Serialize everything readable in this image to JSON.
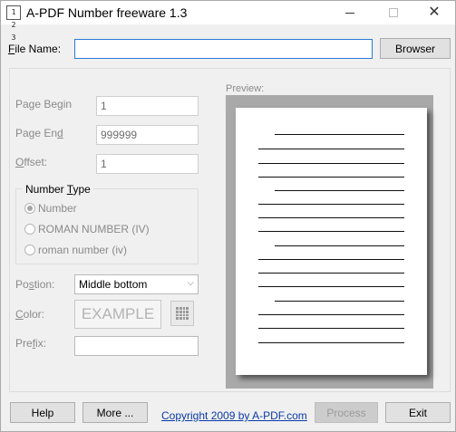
{
  "window": {
    "title": "A-PDF Number freeware 1.3",
    "icon_text": "1 2 3",
    "close_glyph": "✕"
  },
  "file": {
    "label_prefix": "F",
    "label_rest": "ile Name:",
    "value": "",
    "browse_label": "Browser"
  },
  "fields": {
    "page_begin_label": "Page Begin",
    "page_begin_value": "1",
    "page_end_label_a": "Page En",
    "page_end_label_b": "d",
    "page_end_value": "999999",
    "offset_label_a": "O",
    "offset_label_b": "ffset:",
    "offset_value": "1"
  },
  "number_type": {
    "title_a": "Number ",
    "title_b": "T",
    "title_c": "ype",
    "options": [
      {
        "label": "Number",
        "checked": true
      },
      {
        "label": "ROMAN NUMBER (IV)",
        "checked": false
      },
      {
        "label": "roman number (iv)",
        "checked": false
      }
    ]
  },
  "position": {
    "label_a": "Po",
    "label_b": "s",
    "label_c": "tion:",
    "value": "Middle bottom"
  },
  "color": {
    "label_a": "C",
    "label_b": "olor:",
    "example_text": "EXAMPLE"
  },
  "prefix": {
    "label_a": "Pre",
    "label_b": "f",
    "label_c": "ix:",
    "value": ""
  },
  "preview": {
    "label": "Preview:"
  },
  "footer": {
    "help_label": "Help",
    "more_label": "More ...",
    "copyright_link": "Copyright 2009 by A-PDF.com",
    "process_label": "Process",
    "exit_label": "Exit"
  }
}
